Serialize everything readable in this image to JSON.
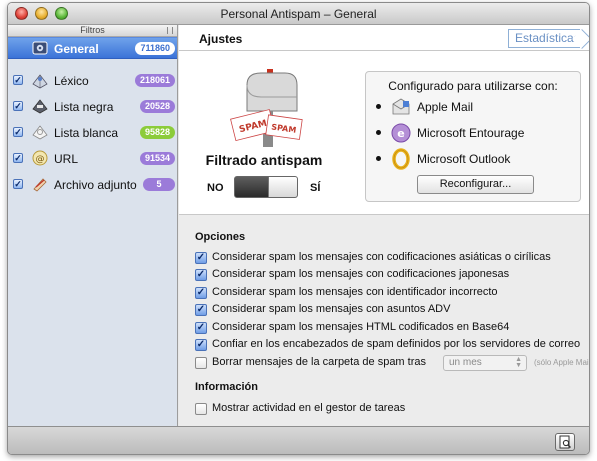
{
  "window": {
    "title": "Personal Antispam – General"
  },
  "sidebar": {
    "header": "Filtros",
    "general": {
      "label": "General",
      "count": "711860"
    },
    "items": [
      {
        "label": "Léxico",
        "count": "218061",
        "color": "#9b7bd9",
        "icon": "lexicon-icon"
      },
      {
        "label": "Lista negra",
        "count": "20528",
        "color": "#9b7bd9",
        "icon": "blacklist-icon"
      },
      {
        "label": "Lista blanca",
        "count": "95828",
        "color": "#8ccc3a",
        "icon": "whitelist-icon"
      },
      {
        "label": "URL",
        "count": "91534",
        "color": "#9b7bd9",
        "icon": "url-icon"
      },
      {
        "label": "Archivo adjunto",
        "count": "5",
        "color": "#9b7bd9",
        "icon": "attachment-icon"
      }
    ]
  },
  "main": {
    "tab": "Ajustes",
    "stats_button": "Estadísticas",
    "filter": {
      "title": "Filtrado antispam",
      "off_label": "NO",
      "on_label": "SÍ",
      "enabled": true,
      "mailbox_text": "SPAM"
    },
    "config": {
      "title": "Configurado para utilizarse con:",
      "clients": [
        {
          "label": "Apple Mail",
          "icon": "apple-mail-icon"
        },
        {
          "label": "Microsoft Entourage",
          "icon": "entourage-icon"
        },
        {
          "label": "Microsoft Outlook",
          "icon": "outlook-icon"
        }
      ],
      "button": "Reconfigurar..."
    },
    "options": {
      "title": "Opciones",
      "items": [
        {
          "label": "Considerar spam los mensajes con codificaciones asiáticas o cirílicas",
          "checked": true
        },
        {
          "label": "Considerar spam los mensajes con codificaciones japonesas",
          "checked": true
        },
        {
          "label": "Considerar spam los mensajes con identificador incorrecto",
          "checked": true
        },
        {
          "label": "Considerar spam los mensajes con asuntos ADV",
          "checked": true
        },
        {
          "label": "Considerar spam los mensajes HTML codificados en Base64",
          "checked": true
        },
        {
          "label": "Confiar en los encabezados de spam definidos por los servidores de correo",
          "checked": true
        },
        {
          "label": "Borrar mensajes de la carpeta de spam tras",
          "checked": false,
          "select": "un mes",
          "hint": "(sólo Apple Mail)"
        }
      ]
    },
    "info": {
      "title": "Información",
      "items": [
        {
          "label": "Mostrar actividad en el gestor de tareas",
          "checked": false
        }
      ]
    }
  },
  "colors": {
    "selection": "#3b73d8",
    "sidebar_bg": "#dbe2ec",
    "badge_purple": "#9b7bd9",
    "badge_green": "#8ccc3a"
  }
}
